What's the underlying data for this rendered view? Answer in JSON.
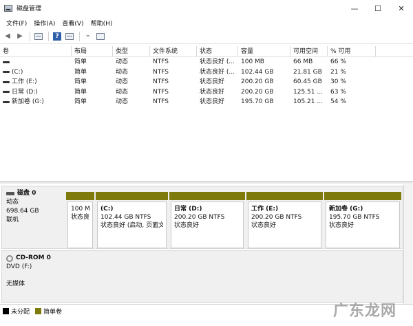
{
  "window": {
    "title": "磁盘管理",
    "controls": {
      "minimize": "—",
      "maximize": "☐",
      "close": "✕"
    }
  },
  "menu": [
    "文件(F)",
    "操作(A)",
    "查看(V)",
    "帮助(H)"
  ],
  "toolbar": {
    "icons": [
      "back-icon",
      "forward-icon",
      "view-icon",
      "help-icon",
      "properties-icon",
      "connect-icon",
      "settings-icon"
    ]
  },
  "table": {
    "columns": [
      "卷",
      "布局",
      "类型",
      "文件系统",
      "状态",
      "容量",
      "可用空间",
      "% 可用"
    ],
    "rows": [
      [
        "",
        "简单",
        "动态",
        "NTFS",
        "状态良好 (...",
        "100 MB",
        "66 MB",
        "66 %"
      ],
      [
        "(C:)",
        "简单",
        "动态",
        "NTFS",
        "状态良好 (...",
        "102.44 GB",
        "21.81 GB",
        "21 %"
      ],
      [
        "工作 (E:)",
        "简单",
        "动态",
        "NTFS",
        "状态良好",
        "200.20 GB",
        "60.45 GB",
        "30 %"
      ],
      [
        "日常 (D:)",
        "简单",
        "动态",
        "NTFS",
        "状态良好",
        "200.20 GB",
        "125.51 ...",
        "63 %"
      ],
      [
        "新加卷 (G:)",
        "简单",
        "动态",
        "NTFS",
        "状态良好",
        "195.70 GB",
        "105.21 ...",
        "54 %"
      ]
    ]
  },
  "disks": [
    {
      "name": "磁盘 0",
      "type": "动态",
      "size": "698.64 GB",
      "status": "联机",
      "partitions": [
        {
          "title": "",
          "size": "100 M",
          "status": "状态良"
        },
        {
          "title": "(C:)",
          "size": "102.44 GB NTFS",
          "status": "状态良好 (启动, 页面文"
        },
        {
          "title": "日常  (D:)",
          "size": "200.20 GB NTFS",
          "status": "状态良好"
        },
        {
          "title": "工作  (E:)",
          "size": "200.20 GB NTFS",
          "status": "状态良好"
        },
        {
          "title": "新加卷  (G:)",
          "size": "195.70 GB NTFS",
          "status": "状态良好"
        }
      ]
    },
    {
      "name": "CD-ROM 0",
      "type": "DVD (F:)",
      "status": "无媒体"
    }
  ],
  "legend": [
    {
      "label": "未分配",
      "color": "#000000"
    },
    {
      "label": "简单卷",
      "color": "#7f7a0c"
    }
  ],
  "watermark": "广东龙网",
  "colors": {
    "partition_bar": "#7f7a0c",
    "unallocated": "#000000"
  }
}
